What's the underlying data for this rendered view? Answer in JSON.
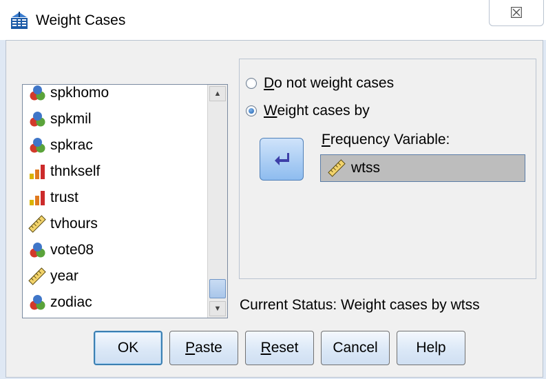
{
  "window": {
    "title": "Weight Cases",
    "close_label": "☒"
  },
  "variables": [
    {
      "name": "spkhomo",
      "type": "nominal-icon"
    },
    {
      "name": "spkmil",
      "type": "nominal-icon"
    },
    {
      "name": "spkrac",
      "type": "nominal-icon"
    },
    {
      "name": "thnkself",
      "type": "ordinal-icon"
    },
    {
      "name": "trust",
      "type": "ordinal-icon"
    },
    {
      "name": "tvhours",
      "type": "scale-icon"
    },
    {
      "name": "vote08",
      "type": "nominal-icon"
    },
    {
      "name": "year",
      "type": "scale-icon"
    },
    {
      "name": "zodiac",
      "type": "nominal-icon"
    }
  ],
  "options": {
    "do_not_weight": {
      "label_first": "D",
      "label_rest": "o not weight cases",
      "selected": false
    },
    "weight_by": {
      "label_first": "W",
      "label_rest": "eight cases by",
      "selected": true
    }
  },
  "frequency": {
    "label_first": "F",
    "label_rest": "requency Variable:",
    "value": "wtss",
    "icon": "scale-icon"
  },
  "status": "Current Status: Weight cases by wtss",
  "buttons": {
    "ok": "OK",
    "paste_first": "P",
    "paste_rest": "aste",
    "reset_first": "R",
    "reset_rest": "eset",
    "cancel": "Cancel",
    "help": "Help"
  },
  "colors": {
    "selected_field": "#bdbdbd",
    "button_blue": "#8ebcef",
    "arrow": "#3d3fa8"
  }
}
